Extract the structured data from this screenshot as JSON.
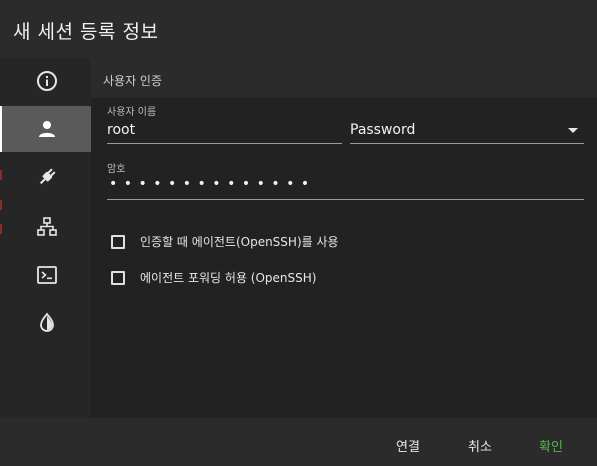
{
  "dialog": {
    "title": "새 세션 등록 정보"
  },
  "sidebar": {
    "items": [
      {
        "icon": "info-icon",
        "active": false
      },
      {
        "icon": "person-icon",
        "active": true
      },
      {
        "icon": "plug-icon",
        "active": false
      },
      {
        "icon": "network-icon",
        "active": false
      },
      {
        "icon": "terminal-icon",
        "active": false
      },
      {
        "icon": "contrast-icon",
        "active": false
      }
    ]
  },
  "auth": {
    "section_title": "사용자 인증",
    "username_label": "사용자 이름",
    "username_value": "root",
    "method_value": "Password",
    "password_label": "암호",
    "password_dots": "••••••••••••••",
    "options": [
      {
        "label": "인증할 때 에이전트(OpenSSH)를 사용",
        "checked": false
      },
      {
        "label": "에이전트 포워딩 허용 (OpenSSH)",
        "checked": false
      }
    ]
  },
  "footer": {
    "connect_label": "연결",
    "cancel_label": "취소",
    "ok_label": "확인"
  },
  "colors": {
    "accent_green": "#57b74e",
    "active_bg": "#5a5a5a",
    "panel_bg": "#222222"
  }
}
